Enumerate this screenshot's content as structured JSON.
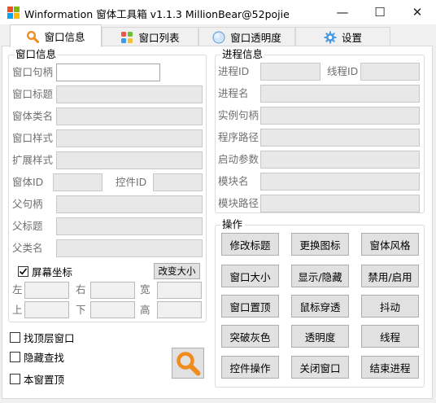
{
  "window": {
    "title": "Winformation 窗体工具箱 v1.1.3  MillionBear@52pojie",
    "minimize_glyph": "—",
    "maximize_glyph": "☐",
    "close_glyph": "✕"
  },
  "tabs": [
    {
      "label": "窗口信息",
      "icon": "search-icon",
      "active": true
    },
    {
      "label": "窗口列表",
      "icon": "windows-logo-icon",
      "active": false
    },
    {
      "label": "窗口透明度",
      "icon": "globe-icon",
      "active": false
    },
    {
      "label": "设置",
      "icon": "gear-icon",
      "active": false
    }
  ],
  "window_info": {
    "group_title": "窗口信息",
    "handle_label": "窗口句柄",
    "title_label": "窗口标题",
    "class_label": "窗体类名",
    "style_label": "窗口样式",
    "exstyle_label": "扩展样式",
    "window_id_label": "窗体ID",
    "control_id_label": "控件ID",
    "parent_handle_label": "父句柄",
    "parent_title_label": "父标题",
    "parent_class_label": "父类名",
    "screen_coords_label": "屏幕坐标",
    "screen_coords_checked": true,
    "resize_label": "改变大小",
    "left_label": "左",
    "right_label": "右",
    "width_label": "宽",
    "top_label": "上",
    "bottom_label": "下",
    "height_label": "高"
  },
  "process_info": {
    "group_title": "进程信息",
    "pid_label": "进程ID",
    "tid_label": "线程ID",
    "name_label": "进程名",
    "instance_label": "实例句柄",
    "path_label": "程序路径",
    "args_label": "启动参数",
    "module_name_label": "模块名",
    "module_path_label": "模块路径"
  },
  "operations": {
    "group_title": "操作",
    "buttons": [
      "修改标题",
      "更换图标",
      "窗体风格",
      "窗口大小",
      "显示/隐藏",
      "禁用/启用",
      "窗口置顶",
      "鼠标穿透",
      "抖动",
      "突破灰色",
      "透明度",
      "线程",
      "控件操作",
      "关闭窗口",
      "结束进程"
    ]
  },
  "options": {
    "find_top_label": "找顶层窗口",
    "hide_search_label": "隐藏查找",
    "topmost_label": "本窗置顶",
    "find_top_checked": false,
    "hide_search_checked": false,
    "topmost_checked": false
  },
  "colors": {
    "accent_orange": "#f08c1e",
    "titlebar_bg": "#ffffff",
    "panel_bg": "#ffffff",
    "readonly_field": "#e8e8e8",
    "button_bg": "#e1e1e1"
  }
}
